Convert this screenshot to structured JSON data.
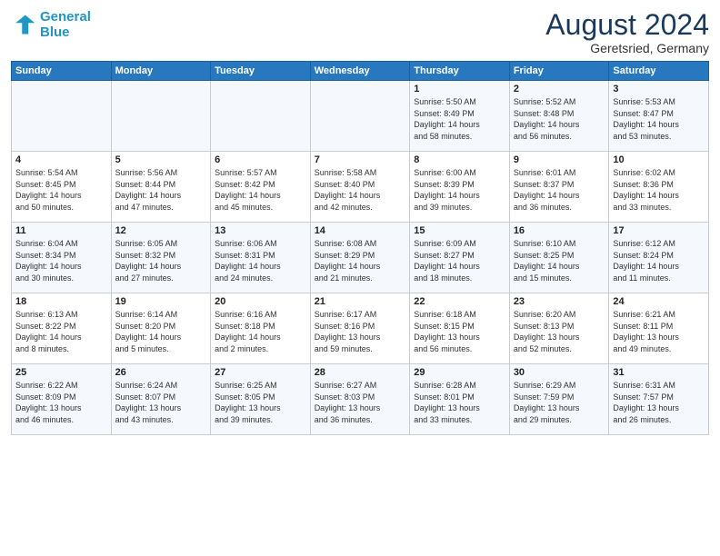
{
  "header": {
    "logo_line1": "General",
    "logo_line2": "Blue",
    "month_title": "August 2024",
    "location": "Geretsried, Germany"
  },
  "weekdays": [
    "Sunday",
    "Monday",
    "Tuesday",
    "Wednesday",
    "Thursday",
    "Friday",
    "Saturday"
  ],
  "weeks": [
    [
      {
        "num": "",
        "info": ""
      },
      {
        "num": "",
        "info": ""
      },
      {
        "num": "",
        "info": ""
      },
      {
        "num": "",
        "info": ""
      },
      {
        "num": "1",
        "info": "Sunrise: 5:50 AM\nSunset: 8:49 PM\nDaylight: 14 hours\nand 58 minutes."
      },
      {
        "num": "2",
        "info": "Sunrise: 5:52 AM\nSunset: 8:48 PM\nDaylight: 14 hours\nand 56 minutes."
      },
      {
        "num": "3",
        "info": "Sunrise: 5:53 AM\nSunset: 8:47 PM\nDaylight: 14 hours\nand 53 minutes."
      }
    ],
    [
      {
        "num": "4",
        "info": "Sunrise: 5:54 AM\nSunset: 8:45 PM\nDaylight: 14 hours\nand 50 minutes."
      },
      {
        "num": "5",
        "info": "Sunrise: 5:56 AM\nSunset: 8:44 PM\nDaylight: 14 hours\nand 47 minutes."
      },
      {
        "num": "6",
        "info": "Sunrise: 5:57 AM\nSunset: 8:42 PM\nDaylight: 14 hours\nand 45 minutes."
      },
      {
        "num": "7",
        "info": "Sunrise: 5:58 AM\nSunset: 8:40 PM\nDaylight: 14 hours\nand 42 minutes."
      },
      {
        "num": "8",
        "info": "Sunrise: 6:00 AM\nSunset: 8:39 PM\nDaylight: 14 hours\nand 39 minutes."
      },
      {
        "num": "9",
        "info": "Sunrise: 6:01 AM\nSunset: 8:37 PM\nDaylight: 14 hours\nand 36 minutes."
      },
      {
        "num": "10",
        "info": "Sunrise: 6:02 AM\nSunset: 8:36 PM\nDaylight: 14 hours\nand 33 minutes."
      }
    ],
    [
      {
        "num": "11",
        "info": "Sunrise: 6:04 AM\nSunset: 8:34 PM\nDaylight: 14 hours\nand 30 minutes."
      },
      {
        "num": "12",
        "info": "Sunrise: 6:05 AM\nSunset: 8:32 PM\nDaylight: 14 hours\nand 27 minutes."
      },
      {
        "num": "13",
        "info": "Sunrise: 6:06 AM\nSunset: 8:31 PM\nDaylight: 14 hours\nand 24 minutes."
      },
      {
        "num": "14",
        "info": "Sunrise: 6:08 AM\nSunset: 8:29 PM\nDaylight: 14 hours\nand 21 minutes."
      },
      {
        "num": "15",
        "info": "Sunrise: 6:09 AM\nSunset: 8:27 PM\nDaylight: 14 hours\nand 18 minutes."
      },
      {
        "num": "16",
        "info": "Sunrise: 6:10 AM\nSunset: 8:25 PM\nDaylight: 14 hours\nand 15 minutes."
      },
      {
        "num": "17",
        "info": "Sunrise: 6:12 AM\nSunset: 8:24 PM\nDaylight: 14 hours\nand 11 minutes."
      }
    ],
    [
      {
        "num": "18",
        "info": "Sunrise: 6:13 AM\nSunset: 8:22 PM\nDaylight: 14 hours\nand 8 minutes."
      },
      {
        "num": "19",
        "info": "Sunrise: 6:14 AM\nSunset: 8:20 PM\nDaylight: 14 hours\nand 5 minutes."
      },
      {
        "num": "20",
        "info": "Sunrise: 6:16 AM\nSunset: 8:18 PM\nDaylight: 14 hours\nand 2 minutes."
      },
      {
        "num": "21",
        "info": "Sunrise: 6:17 AM\nSunset: 8:16 PM\nDaylight: 13 hours\nand 59 minutes."
      },
      {
        "num": "22",
        "info": "Sunrise: 6:18 AM\nSunset: 8:15 PM\nDaylight: 13 hours\nand 56 minutes."
      },
      {
        "num": "23",
        "info": "Sunrise: 6:20 AM\nSunset: 8:13 PM\nDaylight: 13 hours\nand 52 minutes."
      },
      {
        "num": "24",
        "info": "Sunrise: 6:21 AM\nSunset: 8:11 PM\nDaylight: 13 hours\nand 49 minutes."
      }
    ],
    [
      {
        "num": "25",
        "info": "Sunrise: 6:22 AM\nSunset: 8:09 PM\nDaylight: 13 hours\nand 46 minutes."
      },
      {
        "num": "26",
        "info": "Sunrise: 6:24 AM\nSunset: 8:07 PM\nDaylight: 13 hours\nand 43 minutes."
      },
      {
        "num": "27",
        "info": "Sunrise: 6:25 AM\nSunset: 8:05 PM\nDaylight: 13 hours\nand 39 minutes."
      },
      {
        "num": "28",
        "info": "Sunrise: 6:27 AM\nSunset: 8:03 PM\nDaylight: 13 hours\nand 36 minutes."
      },
      {
        "num": "29",
        "info": "Sunrise: 6:28 AM\nSunset: 8:01 PM\nDaylight: 13 hours\nand 33 minutes."
      },
      {
        "num": "30",
        "info": "Sunrise: 6:29 AM\nSunset: 7:59 PM\nDaylight: 13 hours\nand 29 minutes."
      },
      {
        "num": "31",
        "info": "Sunrise: 6:31 AM\nSunset: 7:57 PM\nDaylight: 13 hours\nand 26 minutes."
      }
    ]
  ]
}
